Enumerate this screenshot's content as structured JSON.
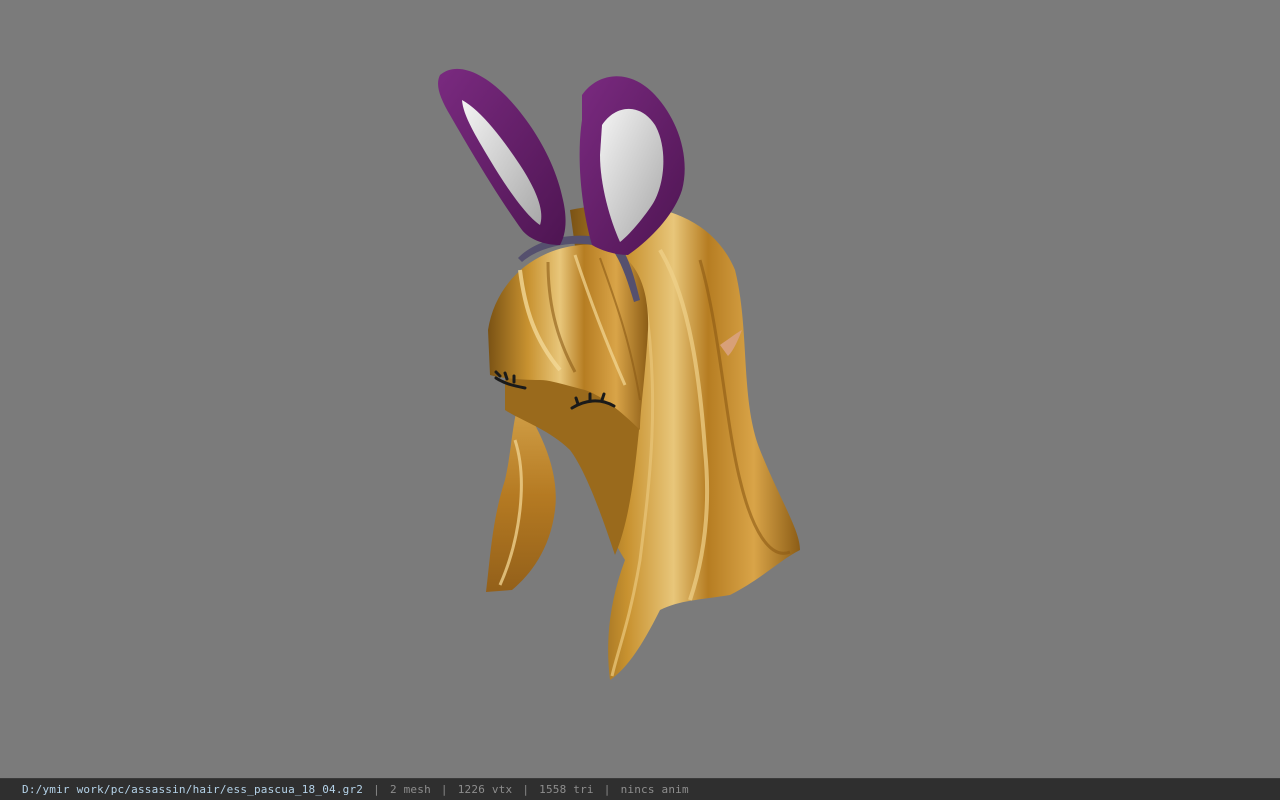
{
  "viewport": {
    "background_color": "#7b7b7b",
    "model": {
      "hair_color": "#c08a2e",
      "ear_color": "#6a1f6e",
      "ear_inner_color": "#e2e2e2",
      "headband_color": "#55506e"
    }
  },
  "status_bar": {
    "file_path": "D:/ymir work/pc/assassin/hair/ess_pascua_18_04.gr2",
    "separator": "|",
    "mesh_count": "2 mesh",
    "vertex_count": "1226 vtx",
    "triangle_count": "1558 tri",
    "animation": "nincs anim"
  }
}
